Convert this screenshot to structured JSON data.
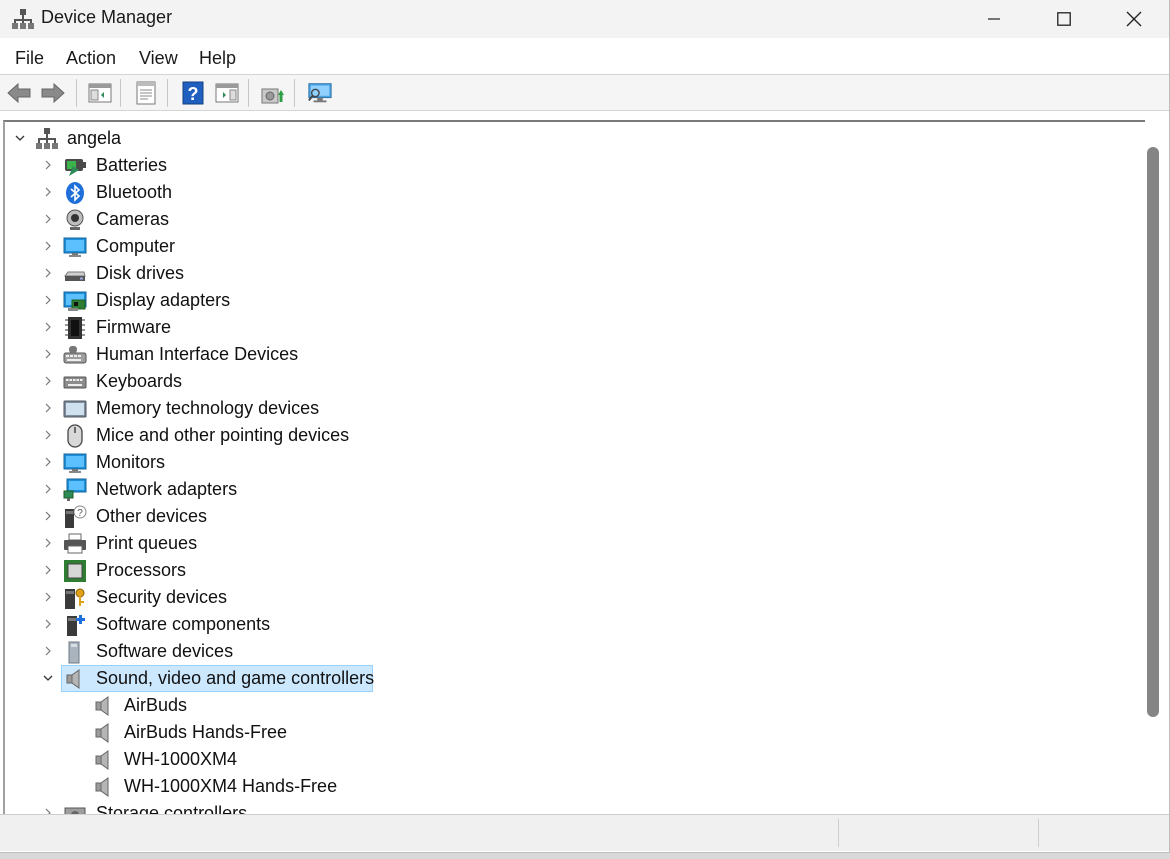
{
  "window": {
    "title": "Device Manager"
  },
  "menu": {
    "items": [
      "File",
      "Action",
      "View",
      "Help"
    ]
  },
  "toolbar": {
    "buttons": [
      "back-arrow-icon",
      "forward-arrow-icon",
      "show-hide-tree-icon",
      "properties-icon",
      "help-icon",
      "action-pane-icon",
      "update-driver-icon",
      "scan-hardware-icon"
    ]
  },
  "tree": {
    "root": "angela",
    "categories": [
      {
        "label": "Batteries",
        "icon": "battery-icon"
      },
      {
        "label": "Bluetooth",
        "icon": "bluetooth-icon"
      },
      {
        "label": "Cameras",
        "icon": "camera-icon"
      },
      {
        "label": "Computer",
        "icon": "computer-icon"
      },
      {
        "label": "Disk drives",
        "icon": "disk-drive-icon"
      },
      {
        "label": "Display adapters",
        "icon": "display-adapter-icon"
      },
      {
        "label": "Firmware",
        "icon": "firmware-icon"
      },
      {
        "label": "Human Interface Devices",
        "icon": "hid-icon"
      },
      {
        "label": "Keyboards",
        "icon": "keyboard-icon"
      },
      {
        "label": "Memory technology devices",
        "icon": "memory-icon"
      },
      {
        "label": "Mice and other pointing devices",
        "icon": "mouse-icon"
      },
      {
        "label": "Monitors",
        "icon": "monitor-icon"
      },
      {
        "label": "Network adapters",
        "icon": "network-icon"
      },
      {
        "label": "Other devices",
        "icon": "other-device-icon"
      },
      {
        "label": "Print queues",
        "icon": "printer-icon"
      },
      {
        "label": "Processors",
        "icon": "processor-icon"
      },
      {
        "label": "Security devices",
        "icon": "security-icon"
      },
      {
        "label": "Software components",
        "icon": "software-component-icon"
      },
      {
        "label": "Software devices",
        "icon": "software-device-icon"
      },
      {
        "label": "Sound, video and game controllers",
        "icon": "speaker-icon",
        "expanded": true,
        "selected": true
      },
      {
        "label": "Storage controllers",
        "icon": "storage-icon"
      }
    ],
    "sound_children": [
      "AirBuds",
      "AirBuds Hands-Free",
      "WH-1000XM4",
      "WH-1000XM4 Hands-Free"
    ]
  },
  "colors": {
    "selection_bg": "#cce8ff",
    "selection_border": "#99d1ff",
    "monitor_blue": "#1e90d8"
  }
}
